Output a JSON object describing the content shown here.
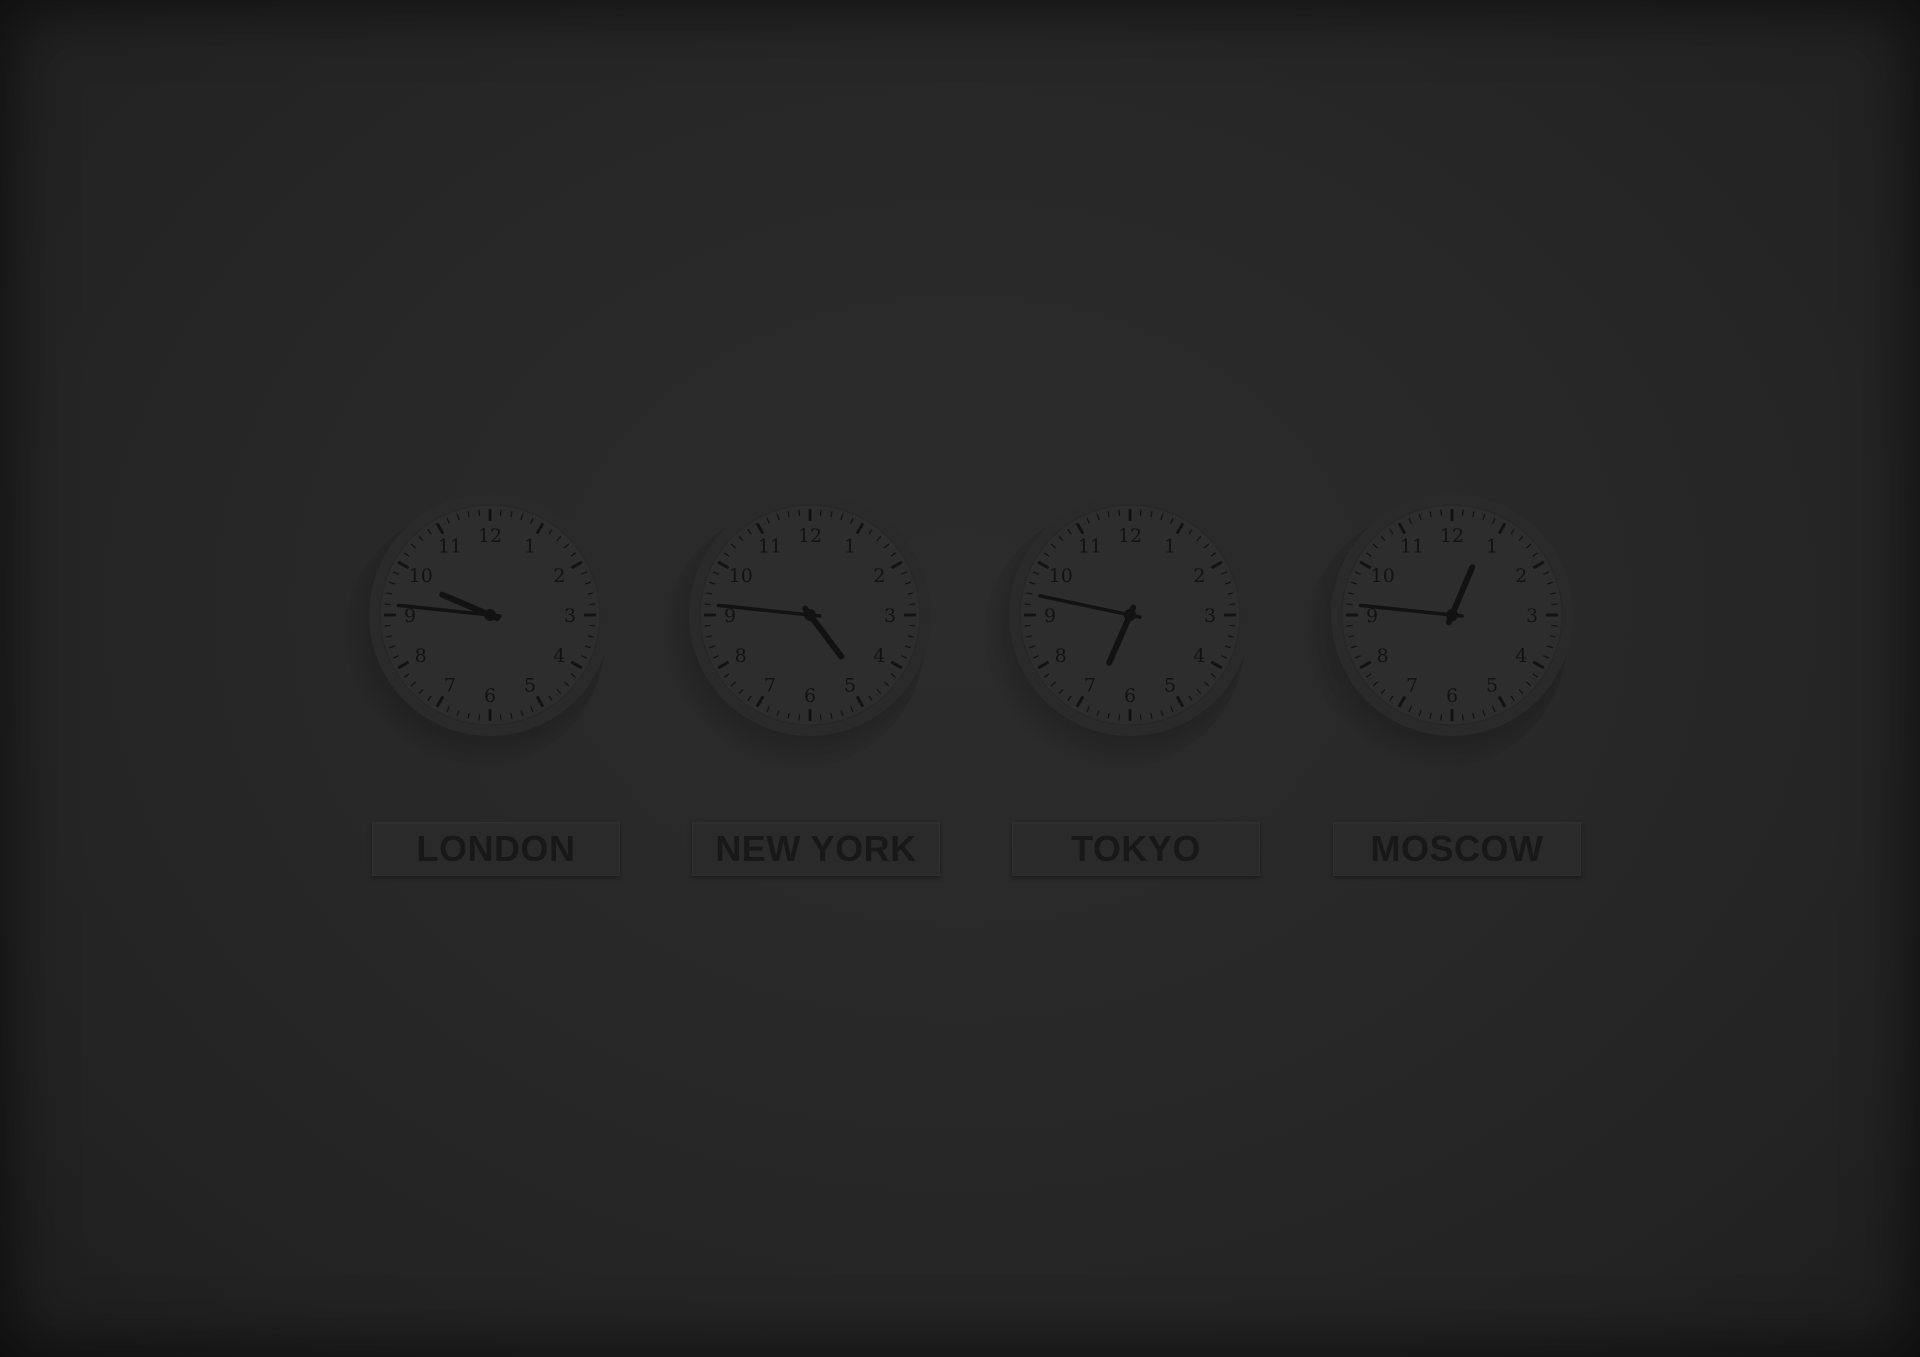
{
  "clocks": [
    {
      "city": "LONDON",
      "hour": 9,
      "minute": 46
    },
    {
      "city": "NEW YORK",
      "hour": 4,
      "minute": 46
    },
    {
      "city": "TOKYO",
      "hour": 6,
      "minute": 47
    },
    {
      "city": "MOSCOW",
      "hour": 12,
      "minute": 46
    }
  ],
  "dial_numbers": [
    "12",
    "1",
    "2",
    "3",
    "4",
    "5",
    "6",
    "7",
    "8",
    "9",
    "10",
    "11"
  ],
  "colors": {
    "wall": "#272727",
    "face": "#2d2d2d",
    "rim": "#2a2a2a",
    "ink": "#121212",
    "label": "#181818"
  }
}
